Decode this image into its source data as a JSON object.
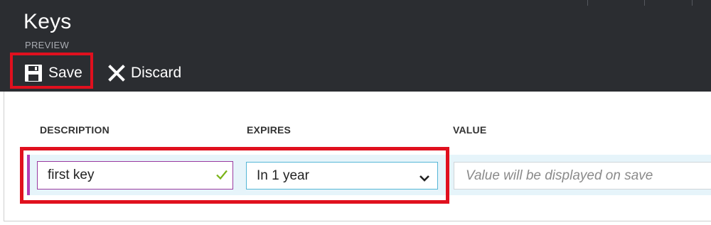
{
  "blade": {
    "title": "Keys",
    "subtitle": "PREVIEW"
  },
  "toolbar": {
    "save_label": "Save",
    "save_icon": "save-icon",
    "discard_label": "Discard",
    "discard_icon": "close-icon"
  },
  "table": {
    "columns": [
      "DESCRIPTION",
      "EXPIRES",
      "VALUE"
    ],
    "row": {
      "description": "first key",
      "description_valid_icon": "checkmark-icon",
      "expires": "In 1 year",
      "expires_icon": "chevron-down-icon",
      "value_placeholder": "Value will be displayed on save"
    }
  },
  "colors": {
    "header_bg": "#2b2d31",
    "highlight": "#e0101e",
    "row_accent": "#b23cb6",
    "valid_check": "#7ab317",
    "select_border": "#55b6d6"
  }
}
